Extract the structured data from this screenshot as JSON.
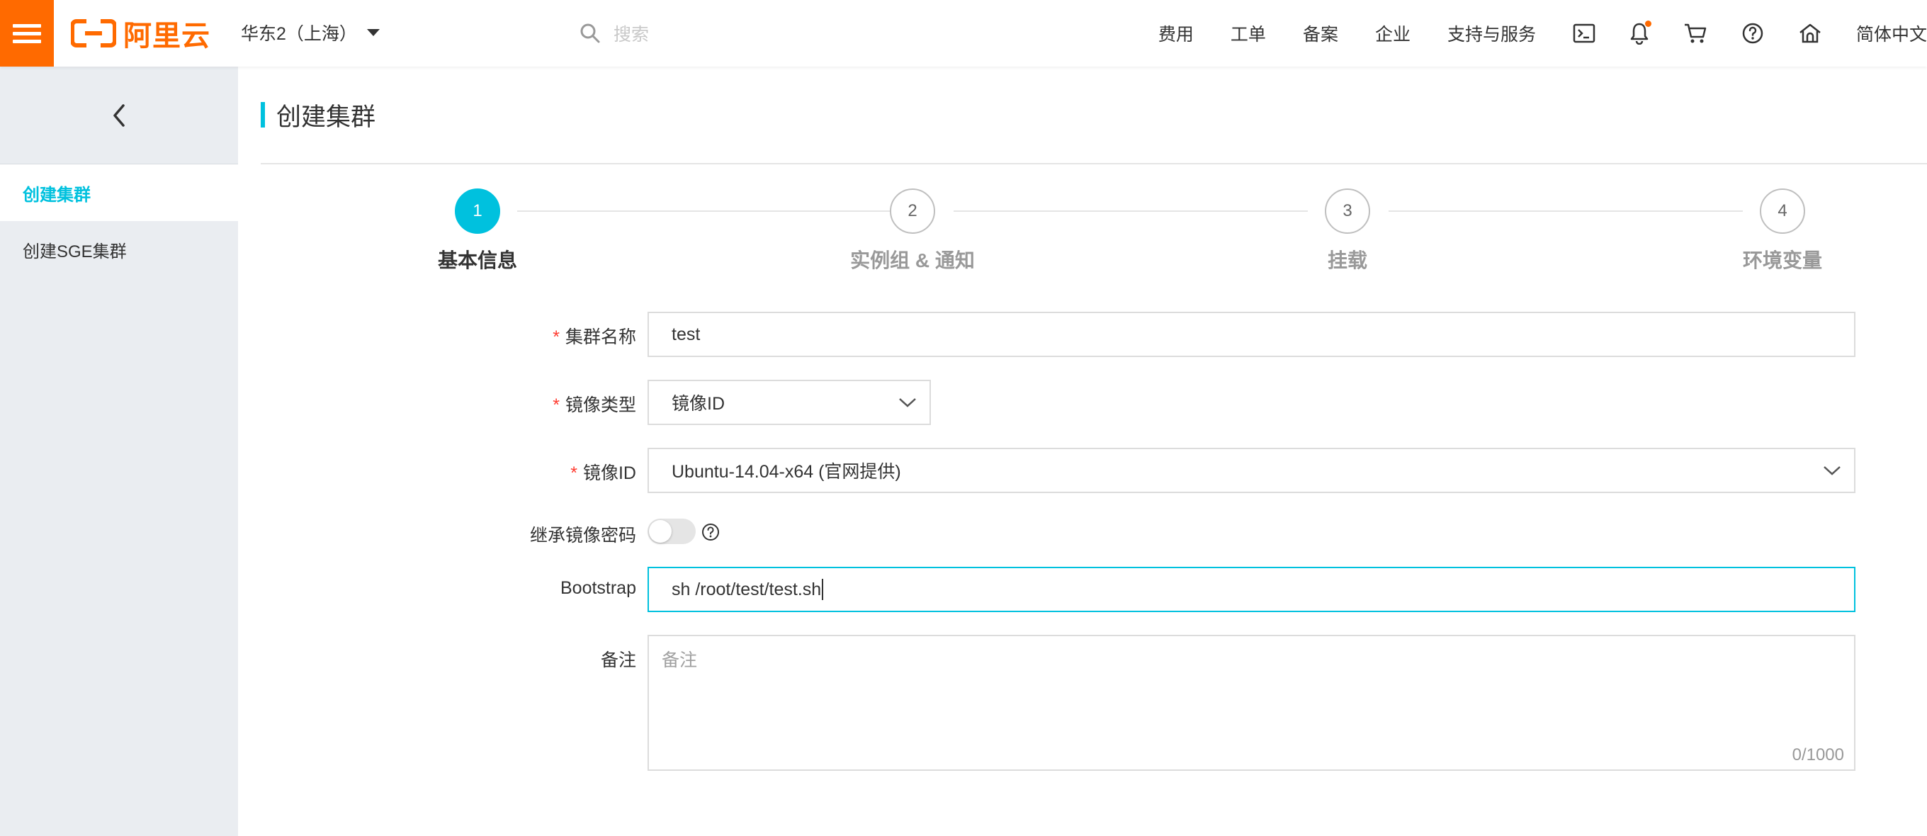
{
  "header": {
    "logo_text": "阿里云",
    "region": "华东2（上海）",
    "search_placeholder": "搜索",
    "nav": [
      "费用",
      "工单",
      "备案",
      "企业",
      "支持与服务"
    ],
    "language": "简体中文"
  },
  "sidebar": {
    "items": [
      {
        "label": "创建集群",
        "active": true
      },
      {
        "label": "创建SGE集群",
        "active": false
      }
    ]
  },
  "page": {
    "title": "创建集群"
  },
  "steps": [
    {
      "number": "1",
      "label": "基本信息",
      "active": true
    },
    {
      "number": "2",
      "label": "实例组 & 通知",
      "active": false
    },
    {
      "number": "3",
      "label": "挂载",
      "active": false
    },
    {
      "number": "4",
      "label": "环境变量",
      "active": false
    }
  ],
  "form": {
    "required_mark": "*",
    "cluster_name": {
      "label": "集群名称",
      "value": "test"
    },
    "image_type": {
      "label": "镜像类型",
      "value": "镜像ID"
    },
    "image_id": {
      "label": "镜像ID",
      "value": "Ubuntu-14.04-x64 (官网提供)"
    },
    "inherit_password": {
      "label": "继承镜像密码",
      "enabled": false
    },
    "bootstrap": {
      "label": "Bootstrap",
      "value": "sh /root/test/test.sh"
    },
    "remark": {
      "label": "备注",
      "placeholder": "备注",
      "counter": "0/1000"
    }
  },
  "colors": {
    "brand_orange": "#ff6a00",
    "accent_cyan": "#00c1de",
    "required_red": "#ff3b30"
  }
}
